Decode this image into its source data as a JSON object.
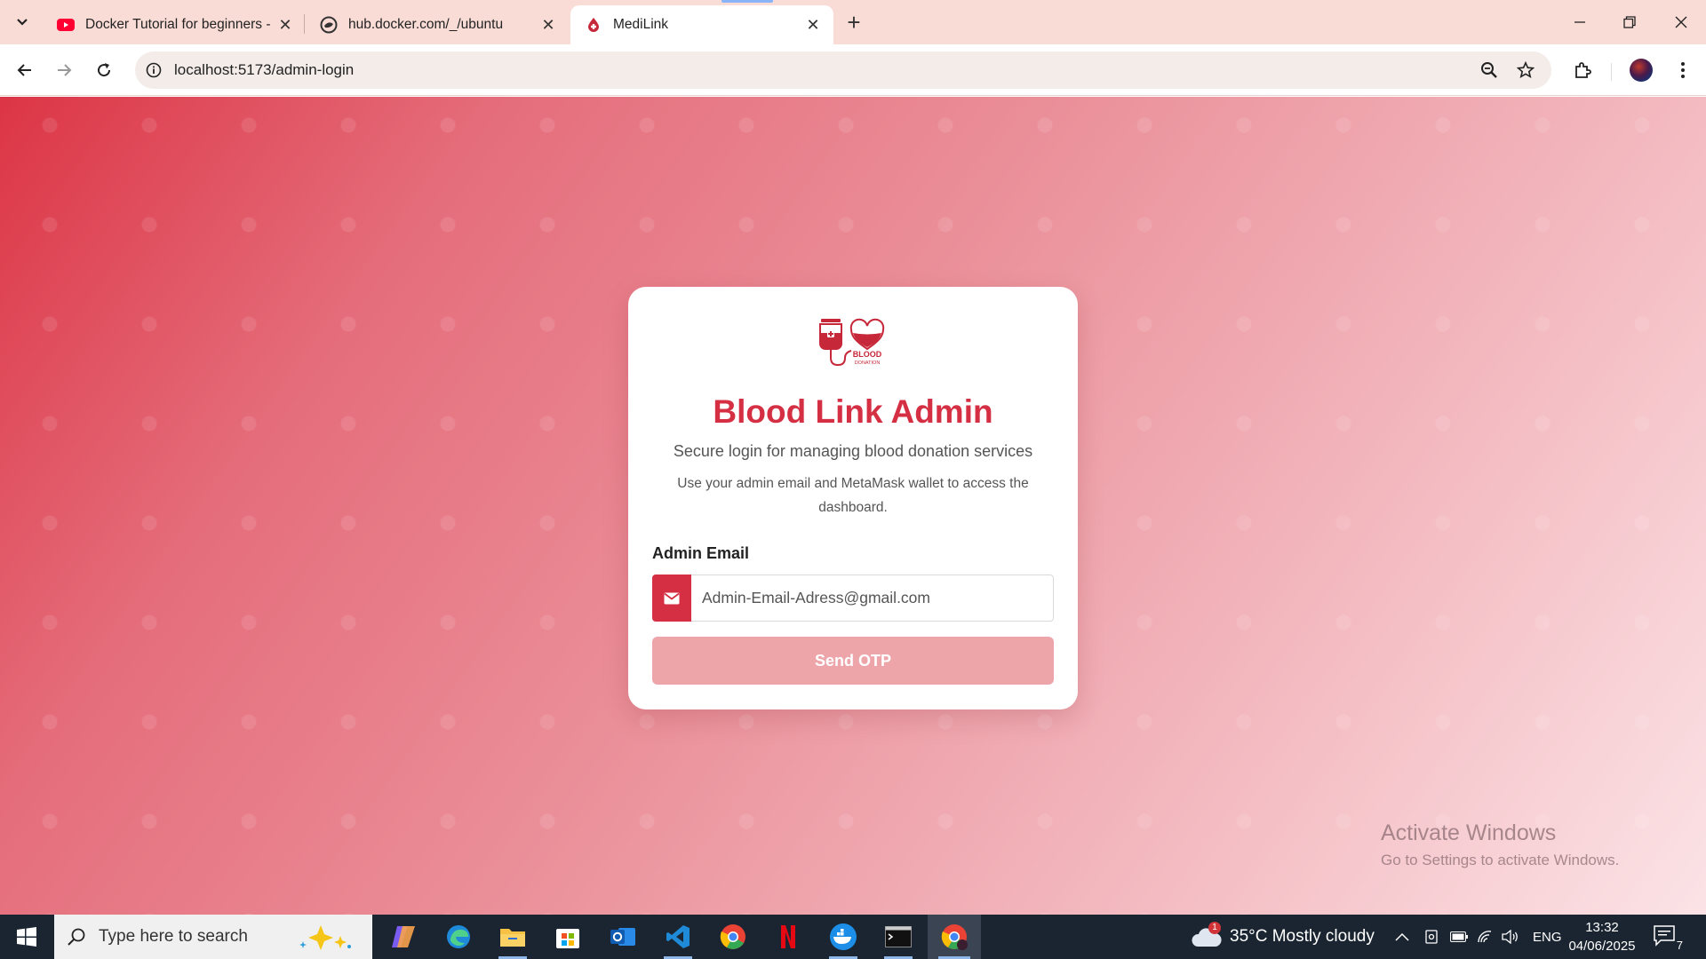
{
  "browser": {
    "tabs": [
      {
        "title": "Docker Tutorial for beginners -",
        "favicon": "youtube-icon",
        "active": false
      },
      {
        "title": "hub.docker.com/_/ubuntu",
        "favicon": "docker-hub-icon",
        "active": false
      },
      {
        "title": "MediLink",
        "favicon": "medilink-icon",
        "active": true
      }
    ],
    "url": "localhost:5173/admin-login"
  },
  "login": {
    "title": "Blood Link Admin",
    "subtitle": "Secure login for managing blood donation services",
    "note": "Use your admin email and MetaMask wallet to access the dashboard.",
    "email_label": "Admin Email",
    "email_placeholder": "Admin-Email-Adress@gmail.com",
    "email_value": "",
    "send_otp_label": "Send OTP",
    "logo_text_1": "BLOOD",
    "logo_text_2": "DONATION",
    "brand_color": "#d52f43"
  },
  "watermark": {
    "line1": "Activate Windows",
    "line2": "Go to Settings to activate Windows."
  },
  "taskbar": {
    "search_placeholder": "Type here to search",
    "weather": "35°C  Mostly cloudy",
    "weather_badge": "1",
    "language": "ENG",
    "time": "13:32",
    "date": "04/06/2025",
    "notifications": "7"
  }
}
